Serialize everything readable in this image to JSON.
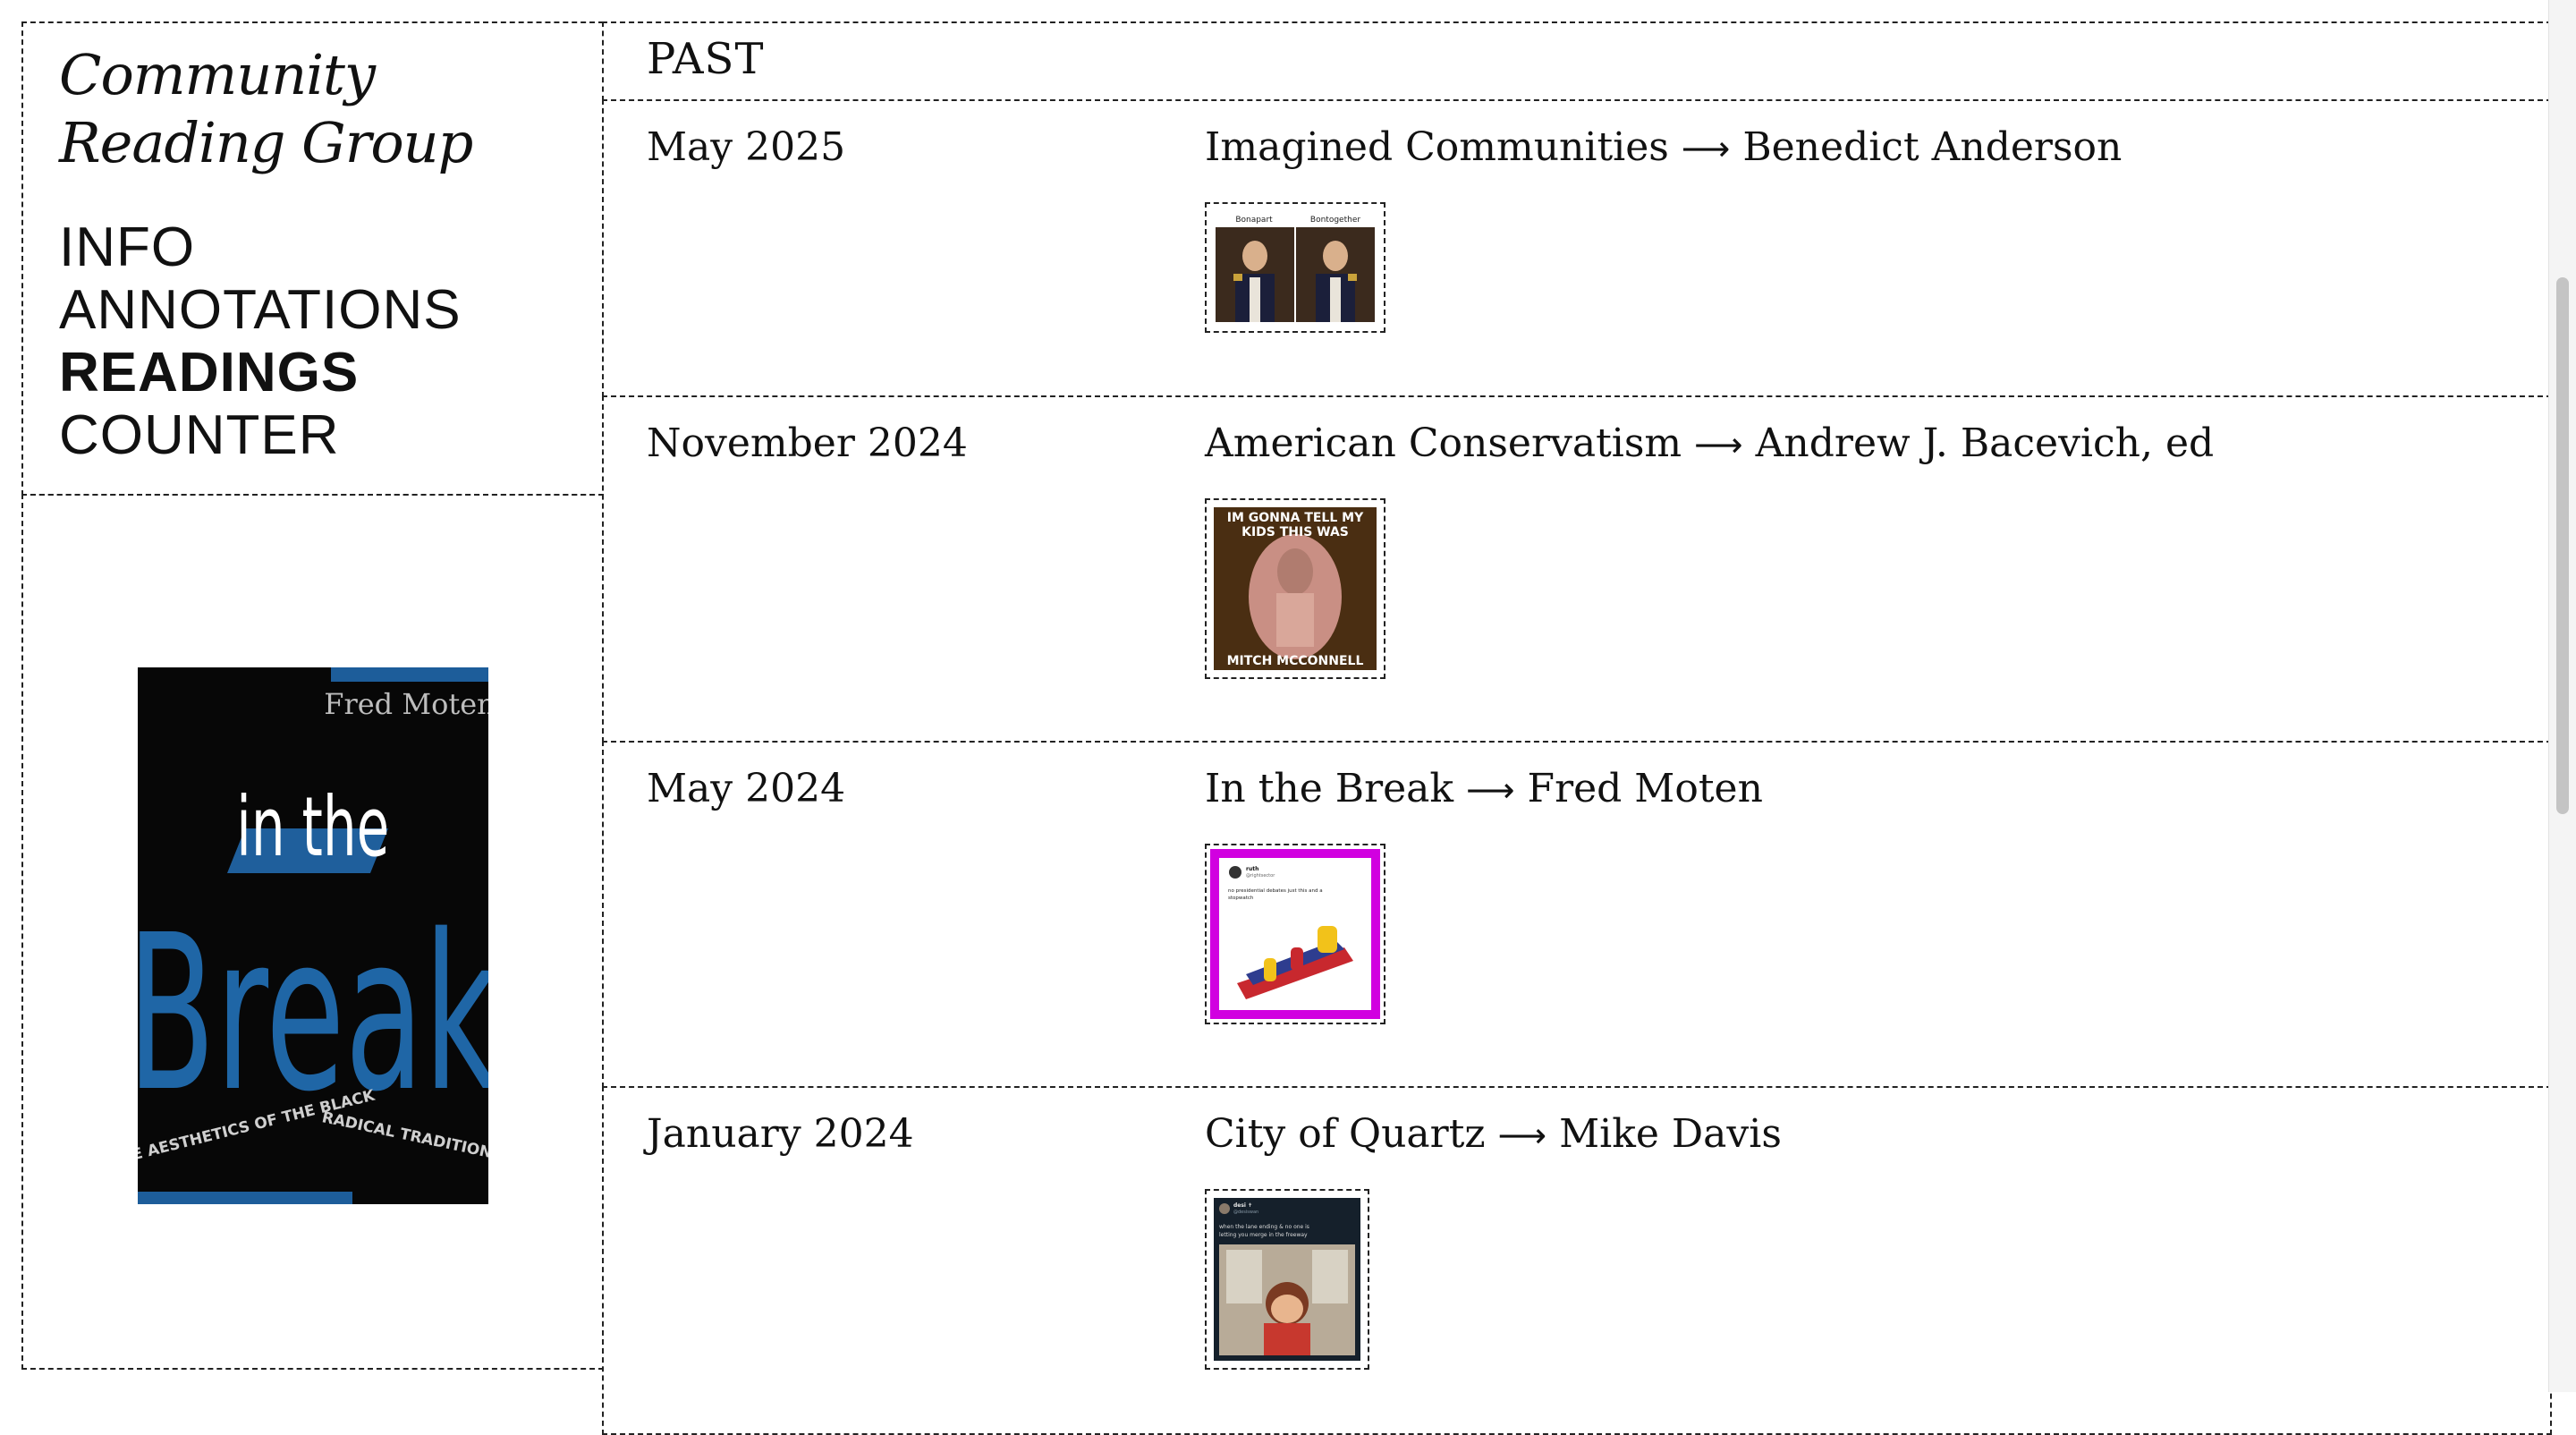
{
  "site": {
    "title_line1": "Community",
    "title_line2": "Reading Group"
  },
  "nav": {
    "items": [
      {
        "label": "INFO",
        "active": false
      },
      {
        "label": "ANNOTATIONS",
        "active": false
      },
      {
        "label": "READINGS",
        "active": true
      },
      {
        "label": "COUNTER",
        "active": false
      }
    ]
  },
  "feature": {
    "cover": {
      "author": "Fred Moten",
      "title_top": "in the",
      "title_main": "Break",
      "subtitle_left": "THE AESTHETICS OF THE BLACK",
      "subtitle_right": "RADICAL TRADITION"
    }
  },
  "readings": {
    "heading": "PAST",
    "arrow": "⟶",
    "items": [
      {
        "date": "May 2025",
        "title": "Imagined Communities",
        "author": "Benedict Anderson",
        "thumb": {
          "icon": "napoleon-meme-image",
          "caption_left": "Bonapart",
          "caption_right": "Bontogether"
        }
      },
      {
        "date": "November 2024",
        "title": "American Conservatism",
        "author": "Andrew J. Bacevich, ed",
        "thumb": {
          "icon": "mitch-mcconnell-meme-image",
          "top_text_1": "IM GONNA TELL MY",
          "top_text_2": "KIDS THIS WAS",
          "bottom_text": "MITCH MCCONNELL"
        }
      },
      {
        "date": "May 2024",
        "title": "In the Break",
        "author": "Fred Moten",
        "thumb": {
          "icon": "inflatable-obstacle-tweet-image",
          "user": "ruth",
          "handle": "@rightsector",
          "tweet_line1": "no presidential debates just this and a",
          "tweet_line2": "stopwatch",
          "border_color": "#d100e0"
        }
      },
      {
        "date": "January 2024",
        "title": "City of Quartz",
        "author": "Mike Davis",
        "thumb": {
          "icon": "freeway-merge-tweet-image",
          "user": "desi ✝",
          "handle": "@desiswan",
          "tweet_line1": "when the lane ending & no one is",
          "tweet_line2": "letting you merge in the freeway"
        }
      }
    ]
  }
}
